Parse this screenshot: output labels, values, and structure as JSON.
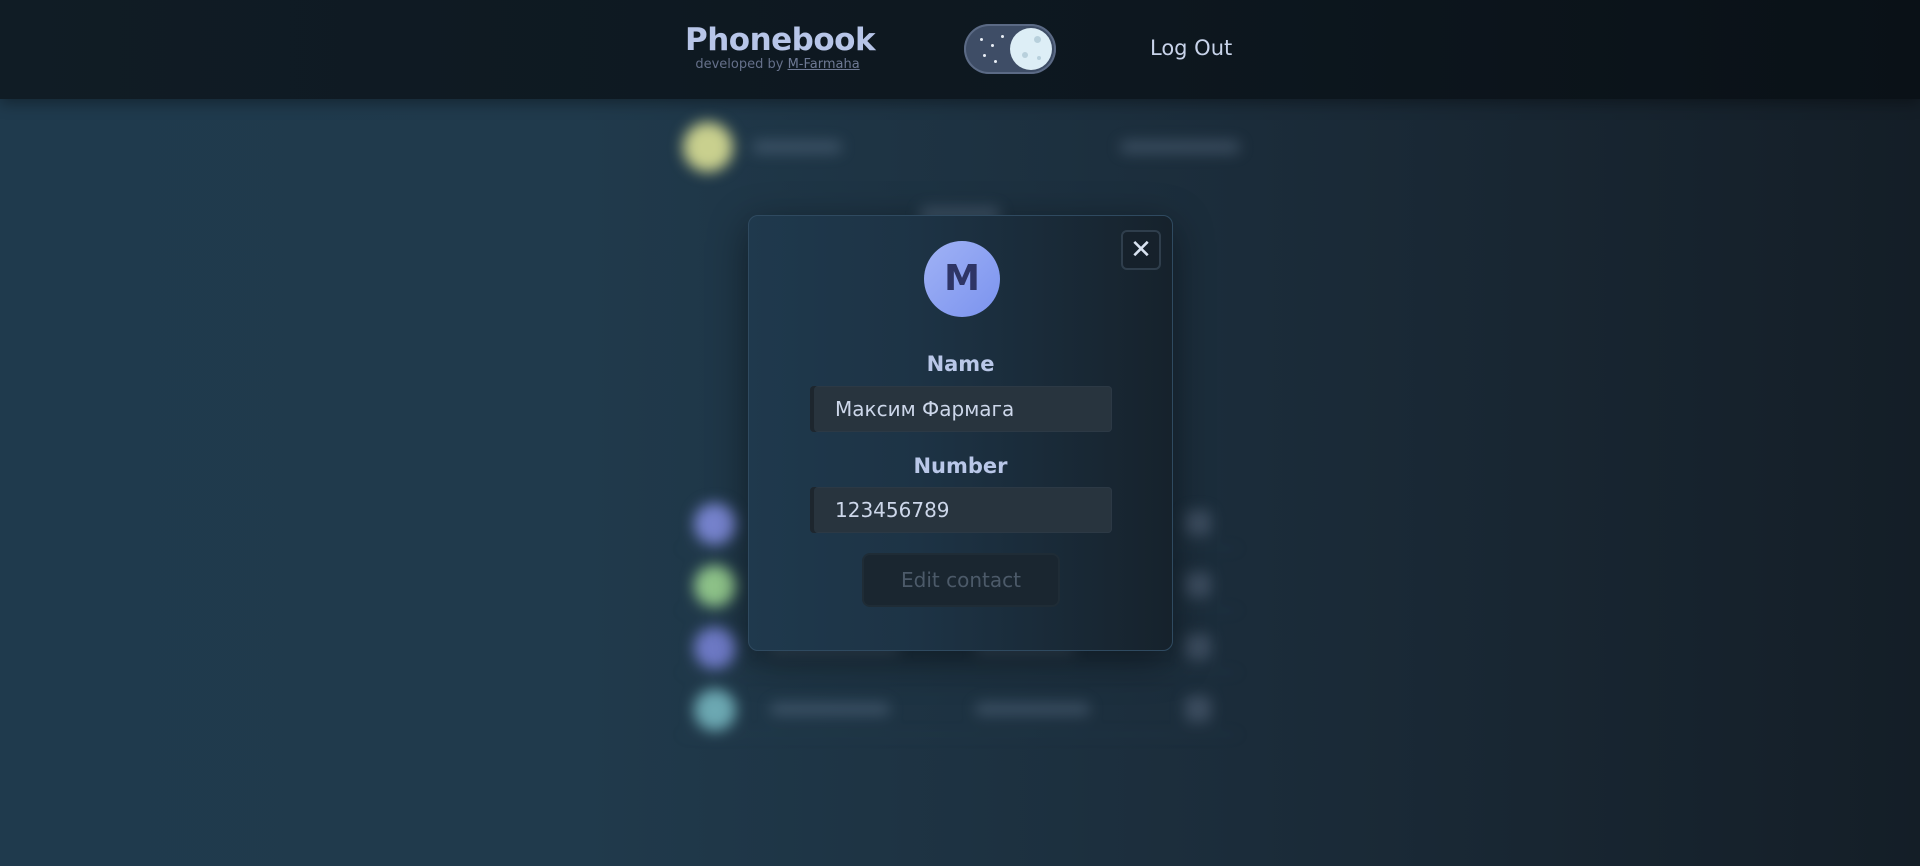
{
  "header": {
    "title": "Phonebook",
    "developed_by": "developed by",
    "developer": "M-Farmaha",
    "theme_toggle_icon": "moon-icon",
    "logout_label": "Log Out"
  },
  "modal": {
    "avatar_letter": "M",
    "close_icon": "close-icon",
    "close_glyph": "✕",
    "name_label": "Name",
    "name_value": "Максим Фармага",
    "number_label": "Number",
    "number_value": "123456789",
    "submit_label": "Edit contact"
  },
  "colors": {
    "accent": "#8ea2f3",
    "header_bg": "#0e1820",
    "modal_bg": "#1d3345"
  }
}
